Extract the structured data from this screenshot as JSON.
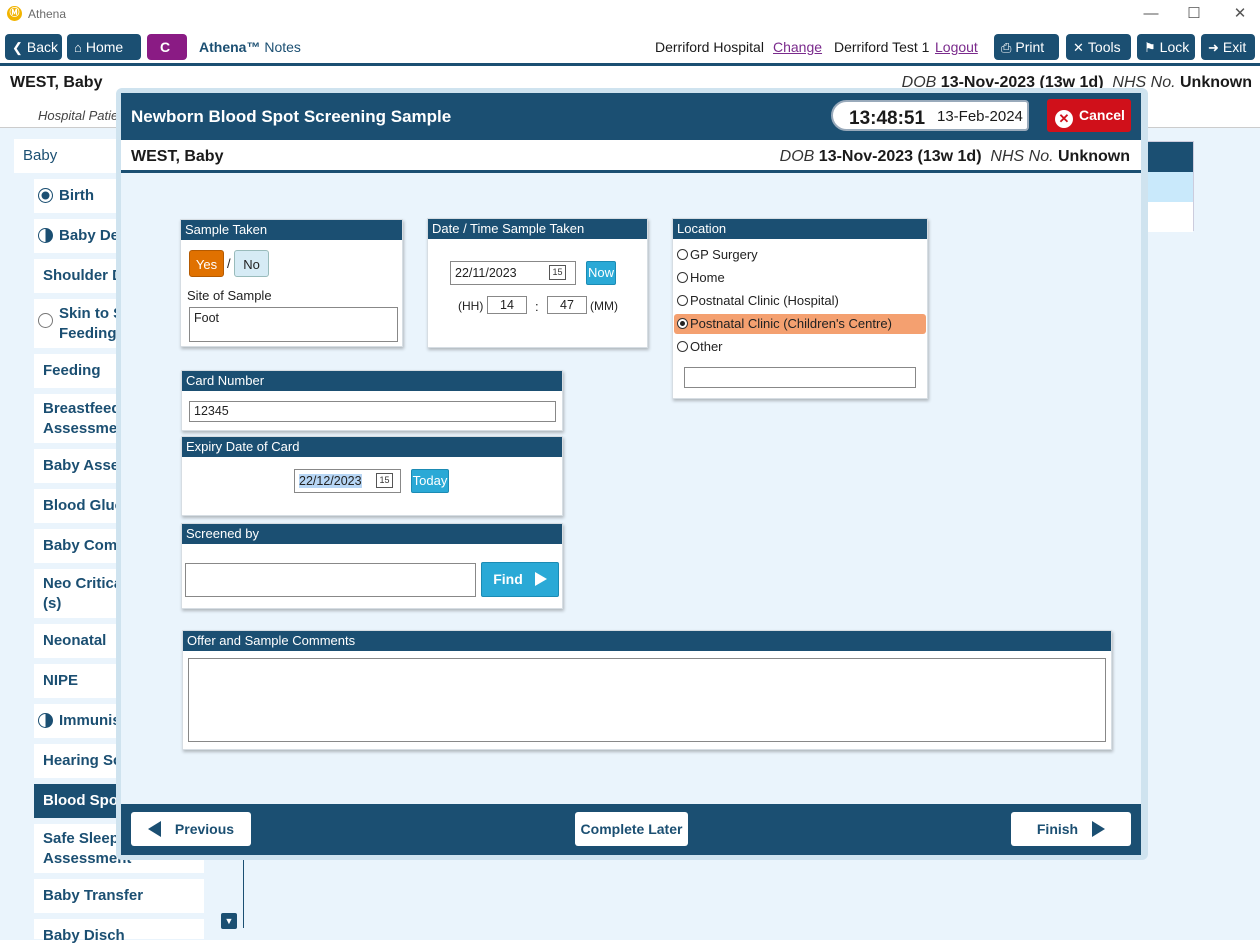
{
  "window": {
    "title": "Athena",
    "logo": "Ⓜ"
  },
  "toolbar": {
    "back": "Back",
    "home": "Home",
    "c_button": "C",
    "app_name": "Athena™",
    "app_section": "Notes",
    "hospital": "Derriford Hospital",
    "change": "Change",
    "user": "Derriford Test 1",
    "logout": "Logout",
    "print": "Print",
    "tools": "Tools",
    "lock": "Lock",
    "exit": "Exit"
  },
  "patient": {
    "name": "WEST, Baby",
    "dob_label": "DOB",
    "dob": "13-Nov-2023 (13w 1d)",
    "nhs_label": "NHS No.",
    "nhs": "Unknown"
  },
  "subbar": {
    "text": "Hospital Patie"
  },
  "sidebar": {
    "header": "Baby",
    "items": [
      {
        "label": "Birth",
        "icon": "radio-filled-icon"
      },
      {
        "label": "Baby Det",
        "icon": "half-circle-icon"
      },
      {
        "label": "Shoulder D",
        "icon": ""
      },
      {
        "label": "Skin to S\nFeeding",
        "icon": "radio-empty-icon"
      },
      {
        "label": "Feeding",
        "icon": ""
      },
      {
        "label": "Breastfeedi\nAssessmen",
        "icon": ""
      },
      {
        "label": "Baby Asses",
        "icon": ""
      },
      {
        "label": "Blood Gluc",
        "icon": ""
      },
      {
        "label": "Baby Comm",
        "icon": ""
      },
      {
        "label": "Neo Critica\n(s)",
        "icon": ""
      },
      {
        "label": "Neonatal",
        "icon": ""
      },
      {
        "label": "NIPE",
        "icon": ""
      },
      {
        "label": "Immunis",
        "icon": "half-circle-icon"
      },
      {
        "label": "Hearing Sc",
        "icon": ""
      },
      {
        "label": "Blood Spot",
        "icon": ""
      },
      {
        "label": "Safe Sleepi\nAssessment",
        "icon": ""
      },
      {
        "label": "Baby Transfer",
        "icon": ""
      },
      {
        "label": "Baby Disch",
        "icon": ""
      }
    ]
  },
  "modal": {
    "title": "Newborn Blood Spot Screening Sample",
    "time": "13:48:51",
    "date": "13-Feb-2024",
    "cancel": "Cancel",
    "sample_taken": {
      "header": "Sample Taken",
      "yes": "Yes",
      "sep": "/",
      "no": "No",
      "selected": "Yes",
      "site_label": "Site of Sample",
      "site_value": "Foot"
    },
    "datetime": {
      "header": "Date / Time Sample Taken",
      "date_value": "22/11/2023",
      "cal_icon_text": "15",
      "now": "Now",
      "hh_label": "(HH)",
      "hh_value": "14",
      "colon": ":",
      "mm_value": "47",
      "mm_label": "(MM)"
    },
    "location": {
      "header": "Location",
      "options": [
        "GP Surgery",
        "Home",
        "Postnatal Clinic (Hospital)",
        "Postnatal Clinic (Children's Centre)",
        "Other"
      ],
      "selected": "Postnatal Clinic (Children's Centre)",
      "other_value": ""
    },
    "card_number": {
      "header": "Card Number",
      "value": "12345"
    },
    "expiry": {
      "header": "Expiry Date of Card",
      "value": "22/12/2023",
      "cal_icon_text": "15",
      "today": "Today"
    },
    "screened_by": {
      "header": "Screened by",
      "value": "",
      "find": "Find"
    },
    "comments": {
      "header": "Offer and Sample Comments",
      "value": ""
    },
    "footer": {
      "previous": "Previous",
      "complete_later": "Complete Later",
      "finish": "Finish"
    }
  },
  "colors": {
    "primary": "#1b4f72",
    "accent_orange": "#e07100",
    "selected_location": "#f4a070",
    "cancel_red": "#d0101a",
    "light_blue": "#2aa9d6",
    "c_button": "#8a1b84"
  }
}
